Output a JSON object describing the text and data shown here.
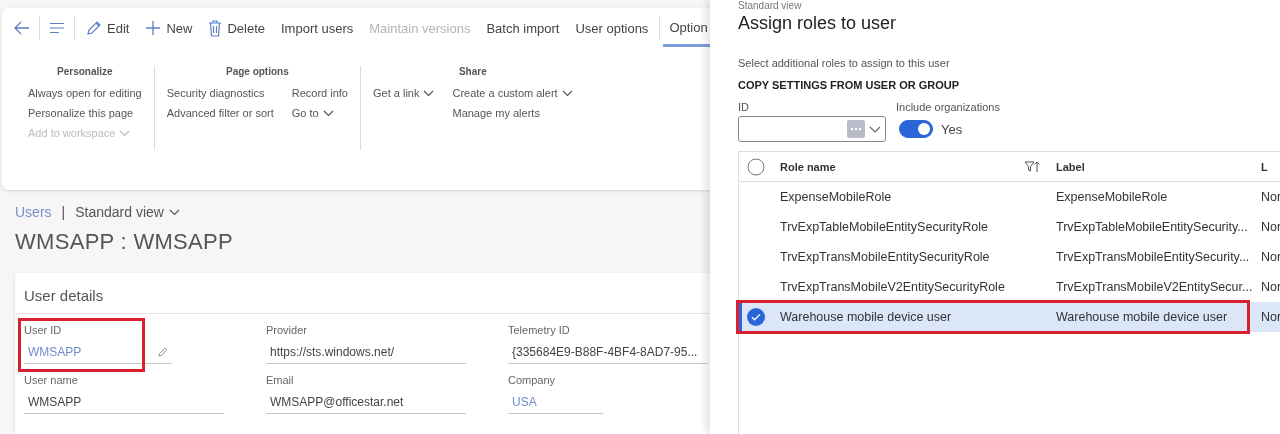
{
  "nav_buttons": [
    {
      "kind": "back"
    },
    {
      "kind": "menu"
    }
  ],
  "actions": [
    {
      "kind": "pencil",
      "label": "Edit",
      "disabled": false
    },
    {
      "kind": "plus",
      "label": "New",
      "disabled": false
    },
    {
      "kind": "trash",
      "label": "Delete",
      "disabled": false
    },
    {
      "kind": "text",
      "label": "Import users",
      "disabled": false
    },
    {
      "kind": "text",
      "label": "Maintain versions",
      "disabled": true
    },
    {
      "kind": "text",
      "label": "Batch import",
      "disabled": false
    },
    {
      "kind": "text",
      "label": "User options",
      "disabled": false
    }
  ],
  "tabs": [
    {
      "label": "Option",
      "selected": true
    }
  ],
  "ribbon_groups": [
    {
      "title": "Personalize",
      "columns": [
        [
          {
            "label": "Always open for editing",
            "disabled": false,
            "dropdown": false
          },
          {
            "label": "Personalize this page",
            "disabled": false,
            "dropdown": false
          },
          {
            "label": "Add to workspace",
            "disabled": true,
            "dropdown": true
          }
        ]
      ]
    },
    {
      "title": "Page options",
      "columns": [
        [
          {
            "label": "Security diagnostics",
            "disabled": false,
            "dropdown": false
          },
          {
            "label": "Advanced filter or sort",
            "disabled": false,
            "dropdown": false
          }
        ],
        [
          {
            "label": "Record info",
            "disabled": false,
            "dropdown": false
          },
          {
            "label": "Go to",
            "disabled": false,
            "dropdown": true
          }
        ]
      ]
    },
    {
      "title": "Share",
      "columns": [
        [
          {
            "label": "Get a link",
            "disabled": false,
            "dropdown": true
          }
        ],
        [
          {
            "label": "Create a custom alert",
            "disabled": false,
            "dropdown": true
          },
          {
            "label": "Manage my alerts",
            "disabled": false,
            "dropdown": false
          }
        ]
      ]
    }
  ],
  "breadcrumb": {
    "link": "Users",
    "separator": "|",
    "view": "Standard view"
  },
  "page_title": "WMSAPP : WMSAPP",
  "user_details": {
    "title": "User details",
    "fields": [
      {
        "kind": "editable",
        "label": "User ID",
        "value": "WMSAPP",
        "link": true,
        "highlighted": true
      },
      {
        "kind": "text",
        "label": "Provider",
        "value": "https://sts.windows.net/",
        "link": false,
        "highlighted": false
      },
      {
        "kind": "text",
        "label": "Telemetry ID",
        "value": "{335684E9-B88F-4BF4-8AD7-95...",
        "link": false,
        "highlighted": false
      },
      {
        "kind": "text",
        "label": "User name",
        "value": "WMSAPP",
        "link": false,
        "highlighted": false
      },
      {
        "kind": "text",
        "label": "Email",
        "value": "WMSAPP@officestar.net",
        "link": false,
        "highlighted": false
      },
      {
        "kind": "lookup",
        "label": "Company",
        "value": "USA",
        "link": true,
        "highlighted": false
      }
    ]
  },
  "panel": {
    "view": "Standard view",
    "title": "Assign roles to user",
    "description": "Select additional roles to assign to this user",
    "section_heading": "COPY SETTINGS FROM USER OR GROUP",
    "id_field": {
      "label": "ID"
    },
    "include_organizations": {
      "label": "Include organizations",
      "on": true,
      "value_text": "Yes"
    },
    "grid": {
      "all_selected": false,
      "columns": [
        {
          "label": "Role name",
          "filter": true
        },
        {
          "label": "Label",
          "filter": false
        },
        {
          "label": "L",
          "filter": false
        }
      ],
      "rows": [
        {
          "cells": [
            "ExpenseMobileRole",
            "ExpenseMobileRole",
            "Nor"
          ],
          "selected": false,
          "highlighted": false
        },
        {
          "cells": [
            "TrvExpTableMobileEntitySecurityRole",
            "TrvExpTableMobileEntitySecurity...",
            "Nor"
          ],
          "selected": false,
          "highlighted": false
        },
        {
          "cells": [
            "TrvExpTransMobileEntitySecurityRole",
            "TrvExpTransMobileEntitySecurity...",
            "Nor"
          ],
          "selected": false,
          "highlighted": false
        },
        {
          "cells": [
            "TrvExpTransMobileV2EntitySecurityRole",
            "TrvExpTransMobileV2EntitySecur...",
            "Nor"
          ],
          "selected": false,
          "highlighted": false
        },
        {
          "cells": [
            "Warehouse mobile device user",
            "Warehouse mobile device user",
            "Nor"
          ],
          "selected": true,
          "highlighted": true
        }
      ]
    }
  }
}
